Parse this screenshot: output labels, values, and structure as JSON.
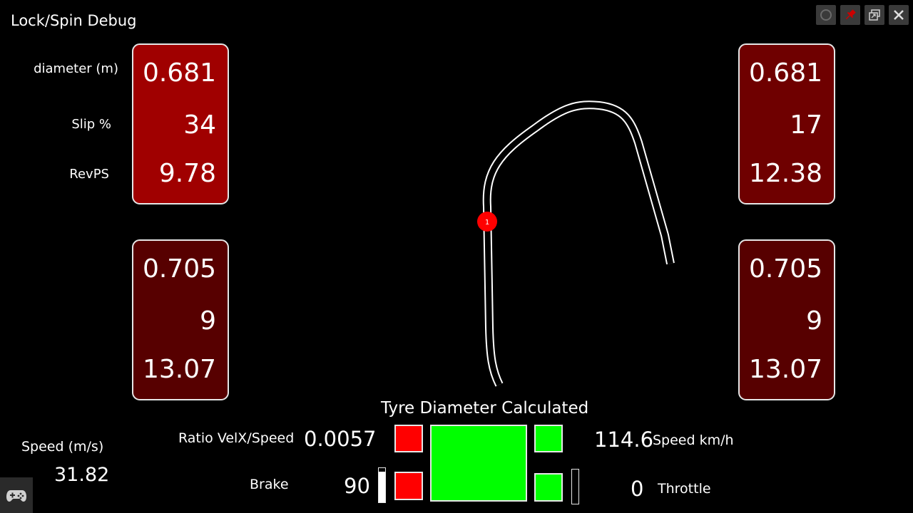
{
  "window": {
    "title": "Lock/Spin Debug"
  },
  "labels": {
    "diameter": "diameter (m)",
    "slip": "Slip %",
    "revps": "RevPS",
    "speed_ms": "Speed (m/s)",
    "ratio": "Ratio VelX/Speed",
    "brake": "Brake",
    "tyre_calc": "Tyre Diameter Calculated",
    "speed_kmh": "Speed km/h",
    "throttle": "Throttle"
  },
  "wheels": {
    "front_left": {
      "diameter": "0.681",
      "slip": "34",
      "revps": "9.78",
      "color": "#a00000"
    },
    "front_right": {
      "diameter": "0.681",
      "slip": "17",
      "revps": "12.38",
      "color": "#6f0000"
    },
    "rear_left": {
      "diameter": "0.705",
      "slip": "9",
      "revps": "13.07",
      "color": "#570000"
    },
    "rear_right": {
      "diameter": "0.705",
      "slip": "9",
      "revps": "13.07",
      "color": "#570000"
    }
  },
  "telemetry": {
    "speed_ms": "31.82",
    "ratio": "0.0057",
    "brake": "90",
    "speed_kmh": "114.6",
    "throttle": "0",
    "brake_level_pct": 90,
    "throttle_level_pct": 0
  },
  "map": {
    "marker_label": "1",
    "marker_color": "#ff0000"
  },
  "icons": [
    "circle-icon",
    "pin-icon",
    "restore-window-icon",
    "close-icon",
    "gamepad-icon"
  ]
}
